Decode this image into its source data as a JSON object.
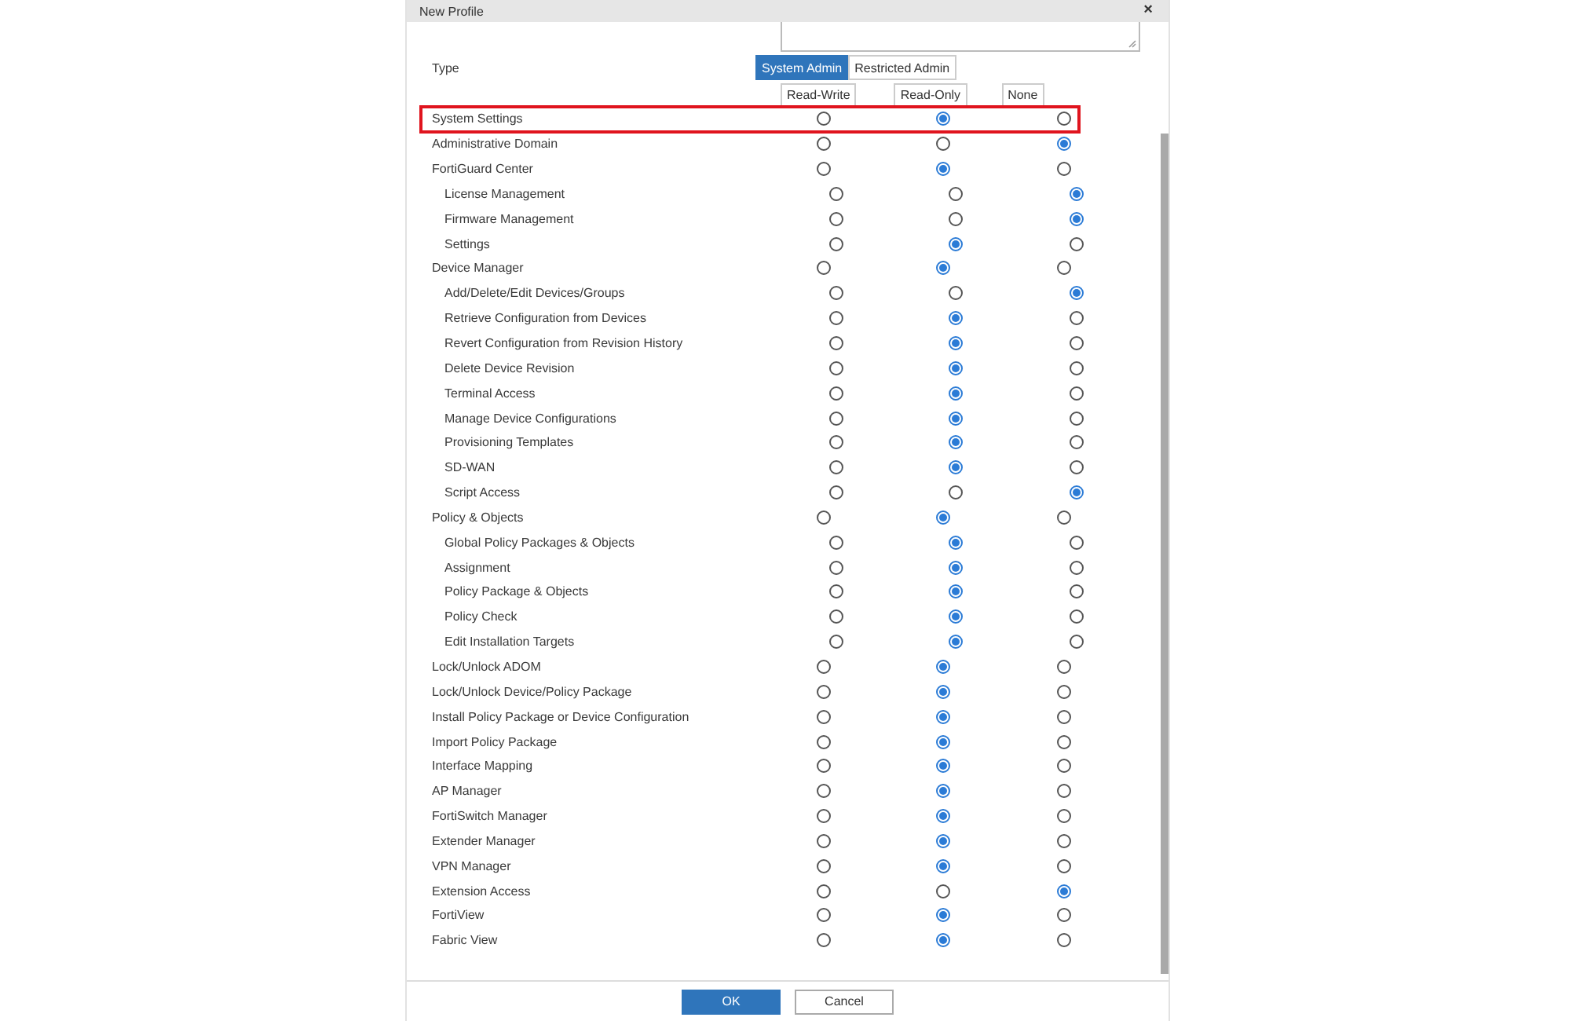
{
  "dialog": {
    "title": "New Profile",
    "close": "×"
  },
  "type_field": {
    "label": "Type",
    "options": [
      {
        "label": "System Admin",
        "selected": true
      },
      {
        "label": "Restricted Admin",
        "selected": false
      }
    ]
  },
  "column_headers": [
    "Read-Write",
    "Read-Only",
    "None"
  ],
  "permissions": [
    {
      "label": "System Settings",
      "highlighted": true,
      "options": [
        {
          "selected": false
        },
        {
          "selected": true
        },
        {
          "selected": false
        }
      ]
    },
    {
      "label": "Administrative Domain",
      "highlighted": false,
      "options": [
        {
          "selected": false
        },
        {
          "selected": false
        },
        {
          "selected": true
        }
      ]
    },
    {
      "label": "FortiGuard Center",
      "highlighted": false,
      "options": [
        {
          "selected": false
        },
        {
          "selected": true
        },
        {
          "selected": false
        }
      ],
      "children": [
        {
          "label": "License Management",
          "highlighted": false,
          "options": [
            {
              "selected": false
            },
            {
              "selected": false
            },
            {
              "selected": true
            }
          ]
        },
        {
          "label": "Firmware Management",
          "highlighted": false,
          "options": [
            {
              "selected": false
            },
            {
              "selected": false
            },
            {
              "selected": true
            }
          ]
        },
        {
          "label": "Settings",
          "highlighted": false,
          "options": [
            {
              "selected": false
            },
            {
              "selected": true
            },
            {
              "selected": false
            }
          ]
        }
      ]
    },
    {
      "label": "Device Manager",
      "highlighted": false,
      "options": [
        {
          "selected": false
        },
        {
          "selected": true
        },
        {
          "selected": false
        }
      ],
      "children": [
        {
          "label": "Add/Delete/Edit Devices/Groups",
          "highlighted": false,
          "options": [
            {
              "selected": false
            },
            {
              "selected": false
            },
            {
              "selected": true
            }
          ]
        },
        {
          "label": "Retrieve Configuration from Devices",
          "highlighted": false,
          "options": [
            {
              "selected": false
            },
            {
              "selected": true
            },
            {
              "selected": false
            }
          ]
        },
        {
          "label": "Revert Configuration from Revision History",
          "highlighted": false,
          "options": [
            {
              "selected": false
            },
            {
              "selected": true
            },
            {
              "selected": false
            }
          ]
        },
        {
          "label": "Delete Device Revision",
          "highlighted": false,
          "options": [
            {
              "selected": false
            },
            {
              "selected": true
            },
            {
              "selected": false
            }
          ]
        },
        {
          "label": "Terminal Access",
          "highlighted": false,
          "options": [
            {
              "selected": false
            },
            {
              "selected": true
            },
            {
              "selected": false
            }
          ]
        },
        {
          "label": "Manage Device Configurations",
          "highlighted": false,
          "options": [
            {
              "selected": false
            },
            {
              "selected": true
            },
            {
              "selected": false
            }
          ]
        },
        {
          "label": "Provisioning Templates",
          "highlighted": false,
          "options": [
            {
              "selected": false
            },
            {
              "selected": true
            },
            {
              "selected": false
            }
          ]
        },
        {
          "label": "SD-WAN",
          "highlighted": false,
          "options": [
            {
              "selected": false
            },
            {
              "selected": true
            },
            {
              "selected": false
            }
          ]
        },
        {
          "label": "Script Access",
          "highlighted": false,
          "options": [
            {
              "selected": false
            },
            {
              "selected": false
            },
            {
              "selected": true
            }
          ]
        }
      ]
    },
    {
      "label": "Policy & Objects",
      "highlighted": false,
      "options": [
        {
          "selected": false
        },
        {
          "selected": true
        },
        {
          "selected": false
        }
      ],
      "children": [
        {
          "label": "Global Policy Packages & Objects",
          "highlighted": false,
          "options": [
            {
              "selected": false
            },
            {
              "selected": true
            },
            {
              "selected": false
            }
          ]
        },
        {
          "label": "Assignment",
          "highlighted": false,
          "options": [
            {
              "selected": false
            },
            {
              "selected": true
            },
            {
              "selected": false
            }
          ]
        },
        {
          "label": "Policy Package & Objects",
          "highlighted": false,
          "options": [
            {
              "selected": false
            },
            {
              "selected": true
            },
            {
              "selected": false
            }
          ]
        },
        {
          "label": "Policy Check",
          "highlighted": false,
          "options": [
            {
              "selected": false
            },
            {
              "selected": true
            },
            {
              "selected": false
            }
          ]
        },
        {
          "label": "Edit Installation Targets",
          "highlighted": false,
          "options": [
            {
              "selected": false
            },
            {
              "selected": true
            },
            {
              "selected": false
            }
          ]
        }
      ]
    },
    {
      "label": "Lock/Unlock ADOM",
      "highlighted": false,
      "options": [
        {
          "selected": false
        },
        {
          "selected": true
        },
        {
          "selected": false
        }
      ]
    },
    {
      "label": "Lock/Unlock Device/Policy Package",
      "highlighted": false,
      "options": [
        {
          "selected": false
        },
        {
          "selected": true
        },
        {
          "selected": false
        }
      ]
    },
    {
      "label": "Install Policy Package or Device Configuration",
      "highlighted": false,
      "options": [
        {
          "selected": false
        },
        {
          "selected": true
        },
        {
          "selected": false
        }
      ]
    },
    {
      "label": "Import Policy Package",
      "highlighted": false,
      "options": [
        {
          "selected": false
        },
        {
          "selected": true
        },
        {
          "selected": false
        }
      ]
    },
    {
      "label": "Interface Mapping",
      "highlighted": false,
      "options": [
        {
          "selected": false
        },
        {
          "selected": true
        },
        {
          "selected": false
        }
      ]
    },
    {
      "label": "AP Manager",
      "highlighted": false,
      "options": [
        {
          "selected": false
        },
        {
          "selected": true
        },
        {
          "selected": false
        }
      ]
    },
    {
      "label": "FortiSwitch Manager",
      "highlighted": false,
      "options": [
        {
          "selected": false
        },
        {
          "selected": true
        },
        {
          "selected": false
        }
      ]
    },
    {
      "label": "Extender Manager",
      "highlighted": false,
      "options": [
        {
          "selected": false
        },
        {
          "selected": true
        },
        {
          "selected": false
        }
      ]
    },
    {
      "label": "VPN Manager",
      "highlighted": false,
      "options": [
        {
          "selected": false
        },
        {
          "selected": true
        },
        {
          "selected": false
        }
      ]
    },
    {
      "label": "Extension Access",
      "highlighted": false,
      "options": [
        {
          "selected": false
        },
        {
          "selected": false
        },
        {
          "selected": true
        }
      ]
    },
    {
      "label": "FortiView",
      "highlighted": false,
      "options": [
        {
          "selected": false
        },
        {
          "selected": true
        },
        {
          "selected": false
        }
      ]
    },
    {
      "label": "Fabric View",
      "highlighted": false,
      "options": [
        {
          "selected": false
        },
        {
          "selected": true
        },
        {
          "selected": false
        }
      ]
    }
  ],
  "buttons": [
    {
      "label": "OK",
      "kind": "primary"
    },
    {
      "label": "Cancel",
      "kind": "secondary"
    }
  ]
}
